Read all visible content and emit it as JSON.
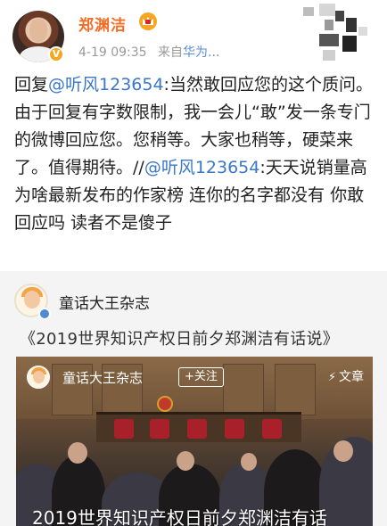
{
  "header": {
    "user_name": "郑渊洁",
    "timestamp": "4-19 09:35",
    "source_prefix": "来自",
    "device": "华为..."
  },
  "post": {
    "reply_prefix": "回复",
    "mention1": "@听风123654",
    "text1": ":当然敢回应您的这个质问。由于回复有字数限制，我一会儿“敢”发一条专门的微博回应您。您稍等。大家也稍等，硬菜来了。值得期待。//",
    "mention2": "@听风123654",
    "text2": ":天天说销量高 为啥最新发布的作家榜 连你的名字都没有 你敢回应吗 读者不是傻子"
  },
  "card": {
    "account_name": "童话大王杂志",
    "title": "《2019世界知识产权日前夕郑渊洁有话说》",
    "video": {
      "account_name": "童话大王杂志",
      "follow_label": "+关注",
      "article_label": "文章",
      "caption": "2019世界知识产权日前夕郑渊洁有话"
    }
  },
  "icons": {
    "verified": "verified-v-icon",
    "crown": "crown-icon",
    "bolt": "lightning-icon"
  },
  "colors": {
    "name_orange": "#f26e26",
    "mention_blue": "#3a77c9",
    "verified_gold": "#f5a623"
  }
}
